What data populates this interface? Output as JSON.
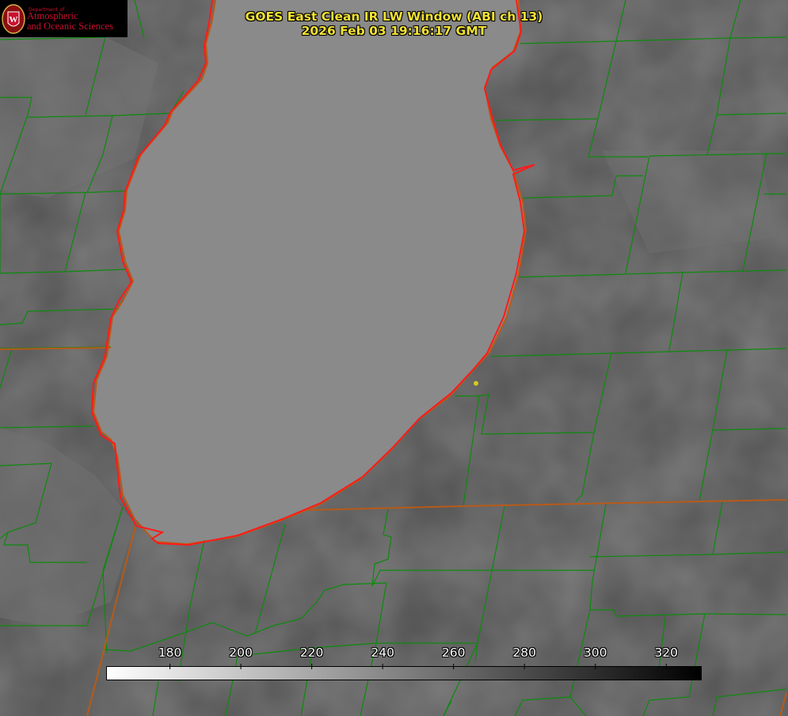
{
  "title": {
    "line1": "GOES East Clean IR LW Window (ABI ch 13)",
    "line2": "2026 Feb 03 19:16:17 GMT"
  },
  "logo": {
    "department": "Department of",
    "line1": "Atmospheric",
    "line2": "and Oceanic Sciences",
    "seal_letter": "W"
  },
  "colorbar": {
    "ticks": [
      "180",
      "200",
      "220",
      "240",
      "260",
      "280",
      "300",
      "320"
    ],
    "range": [
      162,
      330
    ],
    "gradient": [
      "#ffffff",
      "#000000"
    ]
  },
  "colors": {
    "coastline_red": "#ff1a1a",
    "county_lines": "#0d8a0d",
    "state_lines": "#b85a18",
    "title_yellow": "#f2e233",
    "site_marker": "#d8c820"
  }
}
